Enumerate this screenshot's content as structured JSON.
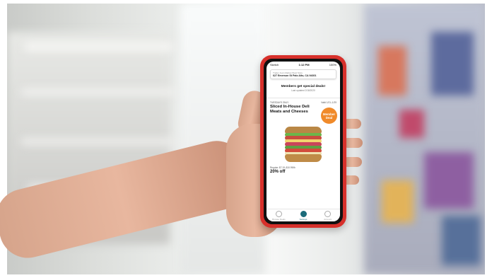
{
  "status_bar": {
    "carrier": "Sketch",
    "time": "1:12 PM",
    "battery": "100%"
  },
  "store": {
    "label": "Trader Joe's Market West Store",
    "address": "627 Emerson St Palo Alto, CA 94301"
  },
  "announcement": {
    "headline": "Members get special deals!",
    "updated": "Last updated 2/18/2020"
  },
  "promo": {
    "eyebrow": "TUESDAYS ONLY",
    "valid": "Valid 1/21–1/29",
    "title": "Sliced In-House Deli Meats and Cheeses",
    "badge": "Member Deal",
    "regular_price": "Regular: $7.19–$10.99/lb",
    "discount": "20% off"
  },
  "tabs": [
    {
      "label": "Browse Deals"
    },
    {
      "label": "Settings"
    },
    {
      "label": "Account"
    }
  ],
  "colors": {
    "phone_case": "#d7302b",
    "badge": "#f08a2a",
    "active_tab": "#1a6b7a"
  }
}
